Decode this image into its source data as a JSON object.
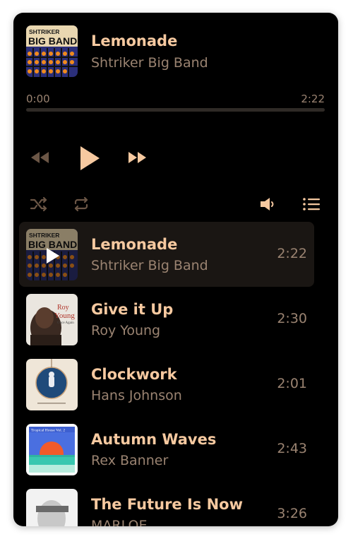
{
  "now_playing": {
    "title": "Lemonade",
    "artist": "Shtriker Big Band",
    "cover_text_top": "SHTRIKER",
    "cover_text_bottom": "BIG BAND",
    "current_time": "0:00",
    "total_time": "2:22",
    "progress": 0
  },
  "controls": {
    "rewind_icon": "rewind-icon",
    "play_icon": "play-icon",
    "fast_forward_icon": "fast-forward-icon",
    "shuffle_icon": "shuffle-icon",
    "repeat_icon": "repeat-icon",
    "volume_icon": "volume-icon",
    "playlist_icon": "playlist-icon"
  },
  "playlist": [
    {
      "title": "Lemonade",
      "artist": "Shtriker Big Band",
      "duration": "2:22",
      "active": true
    },
    {
      "title": "Give it Up",
      "artist": "Roy Young",
      "duration": "2:30",
      "cover_text_1": "Roy",
      "cover_text_2": "Young",
      "cover_text_3": "Once Again"
    },
    {
      "title": "Clockwork",
      "artist": "Hans Johnson",
      "duration": "2:01"
    },
    {
      "title": "Autumn Waves",
      "artist": "Rex Banner",
      "duration": "2:43",
      "cover_text_1": "Tropical House Vol. 2"
    },
    {
      "title": "The Future Is Now",
      "artist": "MARLOE",
      "duration": "3:26"
    }
  ],
  "colors": {
    "accent": "#f6c9a0",
    "muted_text": "#9a8371",
    "background": "#000000",
    "active_row": "#1a1613"
  }
}
